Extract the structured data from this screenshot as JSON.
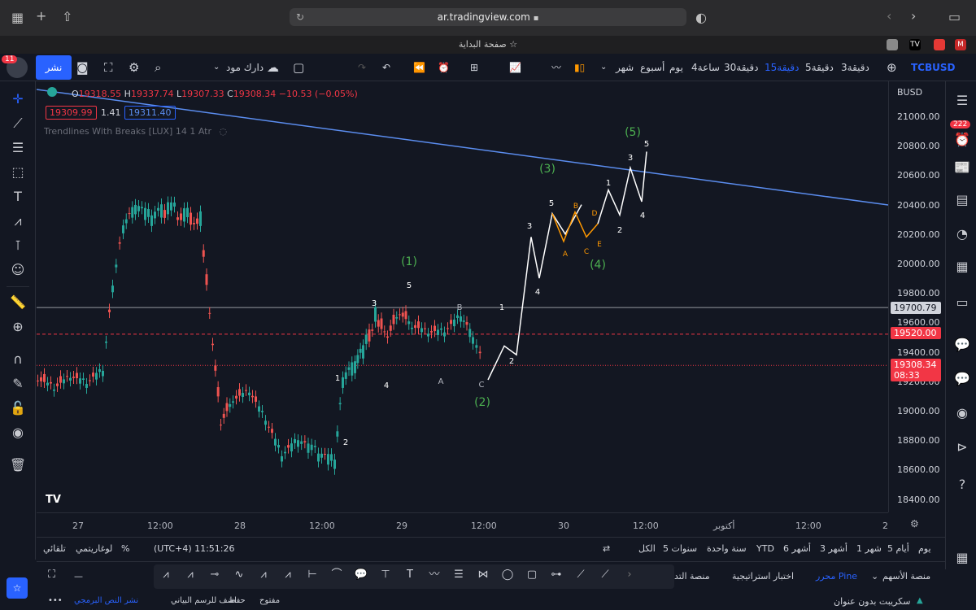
{
  "browser": {
    "url": "ar.tradingview.com",
    "tab_title": "صفحة البداية"
  },
  "toolbar": {
    "publish": "نشر",
    "theme": "دارك مود",
    "symbol": "TCBUSD",
    "intervals": [
      "3دقيقة",
      "5دقيقة",
      "15دقيقة",
      "30دقيقة",
      "4ساعة",
      "يوم",
      "أسبوع",
      "شهر"
    ],
    "active_interval": "15دقيقة",
    "notif_badge": "11"
  },
  "legend": {
    "o_label": "O",
    "o": "19318.55",
    "h_label": "H",
    "h": "19337.74",
    "l_label": "L",
    "l": "19307.33",
    "c_label": "C",
    "c": "19308.34",
    "change": "−10.53 (−0.05%)",
    "bid": "19309.99",
    "spread": "1.41",
    "ask": "19311.40",
    "indicator": "Trendlines With Breaks [LUX] 14 1 Atr"
  },
  "price_scale": {
    "currency": "BUSD",
    "labels": [
      "21000.00",
      "20800.00",
      "20600.00",
      "20400.00",
      "20200.00",
      "20000.00",
      "19800.00",
      "19600.00",
      "19400.00",
      "19200.00",
      "19000.00",
      "18800.00",
      "18600.00",
      "18400.00"
    ],
    "tag_level": "19700.79",
    "tag_dashed": "19520.00",
    "tag_current": "19308.34",
    "tag_countdown": "08:33"
  },
  "time_scale": [
    "27",
    "12:00",
    "28",
    "12:00",
    "29",
    "12:00",
    "30",
    "12:00",
    "أكتوبر",
    "12:00",
    "2"
  ],
  "range_bar": {
    "ranges": [
      "يوم",
      "5 أيام",
      "1 شهر",
      "3 أشهر",
      "6 أشهر",
      "YTD",
      "سنة واحدة",
      "5 سنوات",
      "الكل"
    ],
    "clock": "(UTC+4) 11:51:26",
    "percent": "%",
    "log": "لوغاريتمي",
    "auto": "تلقائي"
  },
  "bottom_panel": {
    "stock_screener": "منصة الأسهم",
    "pine_editor": "محرر Pine",
    "strategy_tester": "اختبار استراتيجية",
    "trading_panel": "منصة التد"
  },
  "status_bar": {
    "script_name": "سكريبت بدون عنوان",
    "open": "مفتوح",
    "save": "حفظ",
    "add_to_chart": "اضف للرسم البياني",
    "publish_script": "نشر النص البرمجي"
  },
  "right_badge": "222",
  "wave_labels": {
    "major": [
      "(1)",
      "(2)",
      "(3)",
      "(4)",
      "(5)"
    ],
    "minor": [
      "1",
      "2",
      "3",
      "4",
      "5",
      "A",
      "B",
      "C",
      "D",
      "E"
    ]
  },
  "colors": {
    "up": "#26a69a",
    "down": "#ef5350",
    "accent": "#2962ff",
    "wave_green": "#4caf50",
    "wave_orange": "#ff9800",
    "trendline": "#5b8def"
  }
}
